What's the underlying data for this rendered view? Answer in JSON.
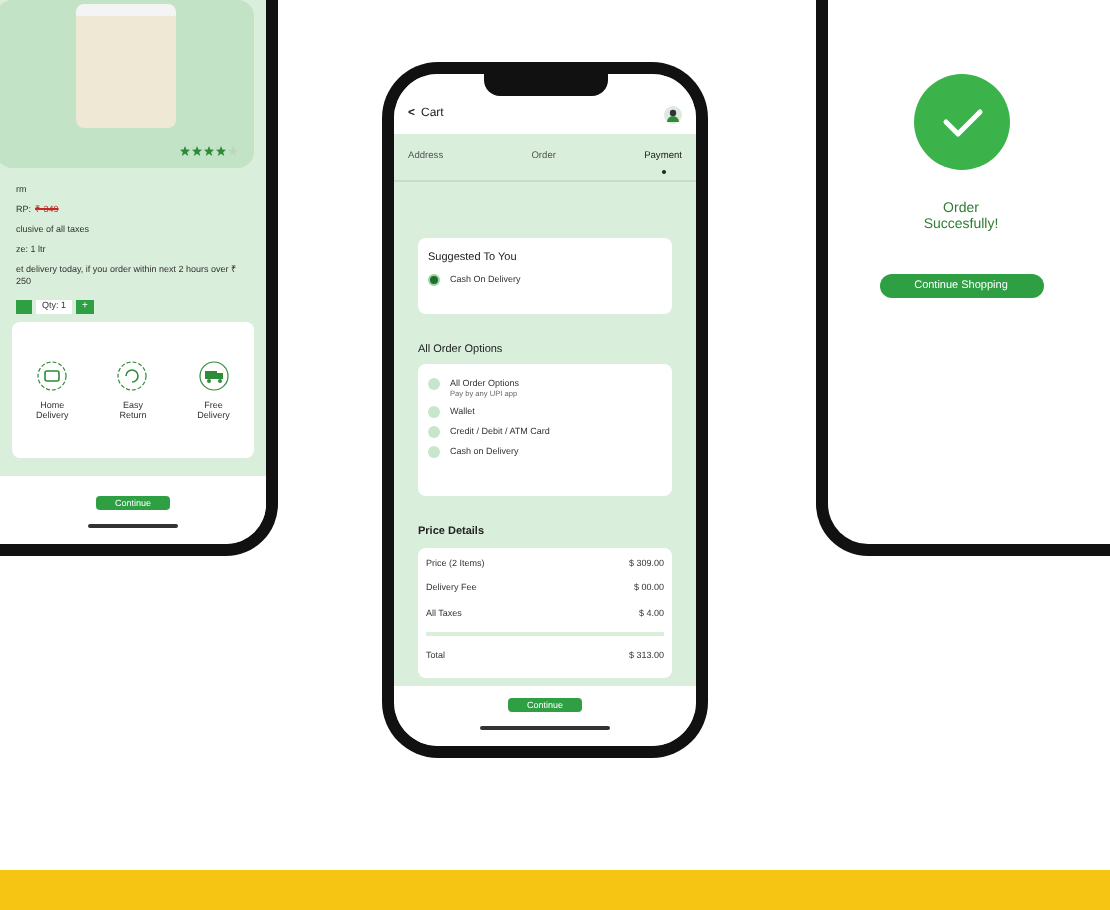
{
  "product_screen": {
    "stars": 4,
    "details": [
      {
        "kind": "plain",
        "text": "rm"
      },
      {
        "kind": "mrp",
        "text": "RP:",
        "struck": "₹ 349"
      },
      {
        "kind": "plain",
        "text": "clusive of all taxes"
      },
      {
        "kind": "plain",
        "text": "ze: 1 ltr"
      },
      {
        "kind": "plain",
        "text": "et delivery today, if you order within next 2 hours over ₹ 250"
      }
    ],
    "quantity": "Qty: 1",
    "plus": "+",
    "features": [
      {
        "kind": "cash",
        "label": "Home Delivery"
      },
      {
        "kind": "return",
        "label": "Easy Return"
      },
      {
        "kind": "truck",
        "label": "Free Delivery"
      }
    ],
    "continue_button": "Continue"
  },
  "cart_screen": {
    "back": "<",
    "title": "Cart",
    "steps": [
      {
        "label": "Address",
        "selected": false
      },
      {
        "label": "Order",
        "selected": false
      },
      {
        "label": "Payment",
        "selected": true
      }
    ],
    "suggested": {
      "heading": "Suggested To You",
      "options": [
        {
          "label": "Cash On Delivery",
          "selected": true
        }
      ]
    },
    "all_options": {
      "heading": "All Order Options",
      "options": [
        {
          "label": "All Order Options",
          "sublabel": "Pay by any UPI app",
          "selected": false
        },
        {
          "label": "Wallet",
          "selected": false
        },
        {
          "label": "Credit / Debit / ATM Card",
          "selected": false
        },
        {
          "label": "Cash on Delivery",
          "selected": false
        }
      ]
    },
    "price_details": {
      "heading": "Price Details",
      "rows": [
        {
          "label": "Price (2 Items)",
          "value": "$ 309.00"
        },
        {
          "label": "Delivery Fee",
          "value": "$ 00.00"
        },
        {
          "label": "All Taxes",
          "value": "$ 4.00"
        }
      ],
      "total": {
        "label": "Total",
        "value": "$ 313.00"
      }
    },
    "continue_button": "Continue"
  },
  "success_screen": {
    "message": "Order Succesfully!",
    "button": "Continue Shopping"
  }
}
